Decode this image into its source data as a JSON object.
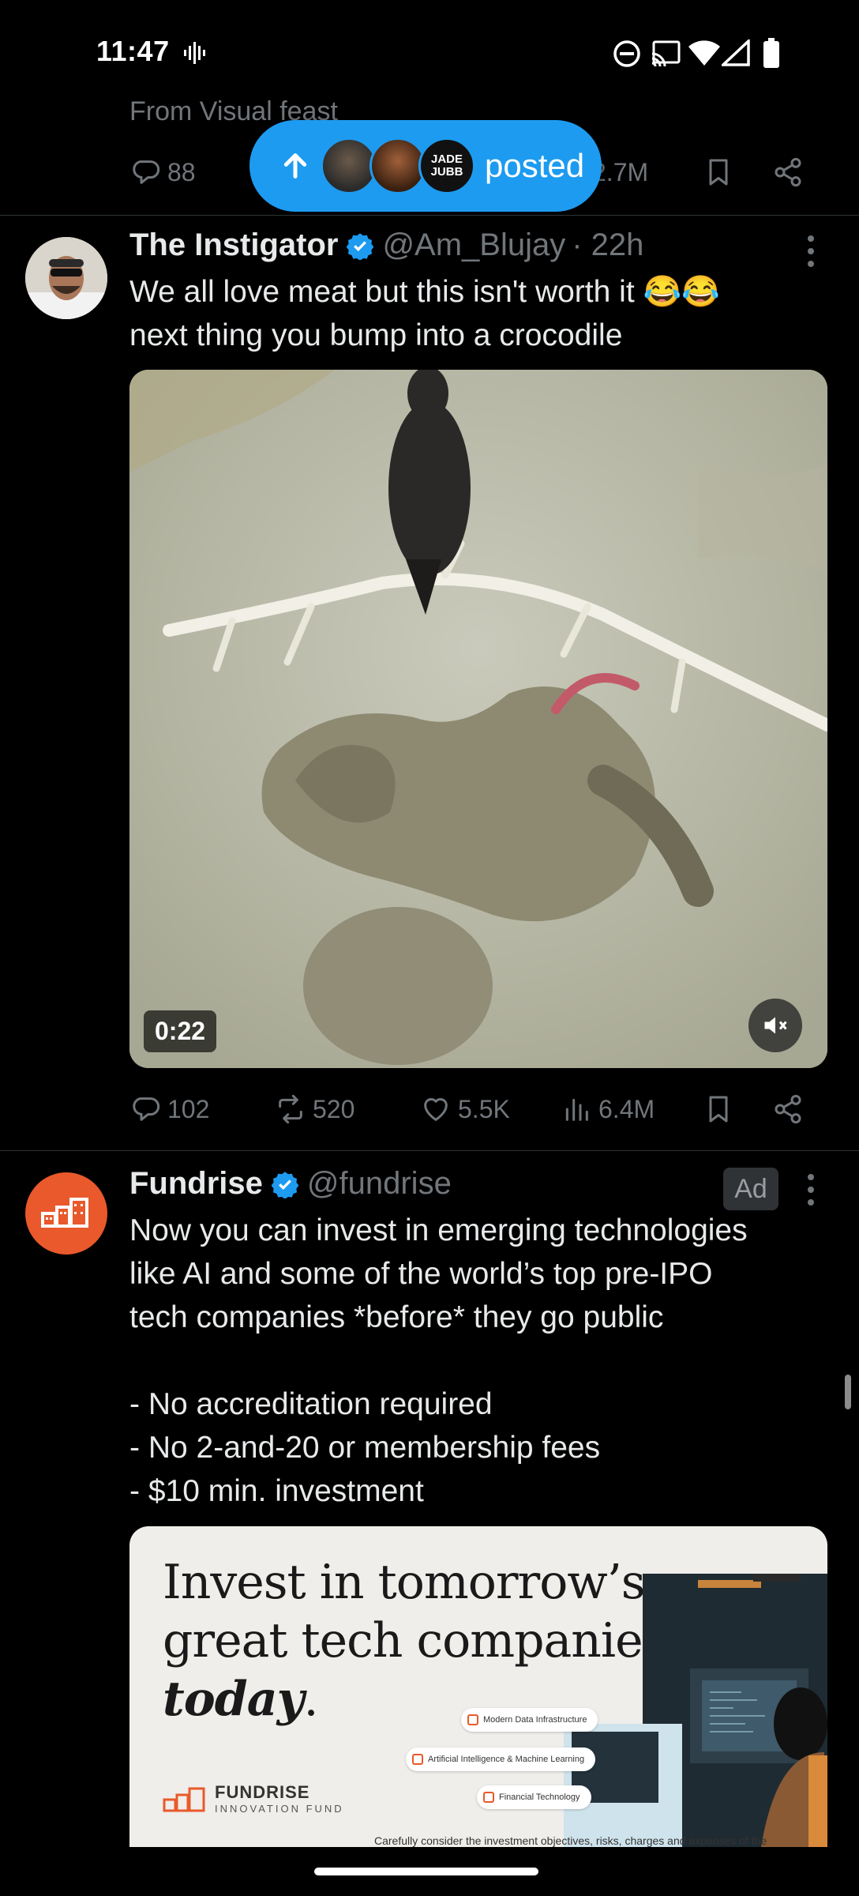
{
  "status_bar": {
    "time": "11:47"
  },
  "prev_tweet": {
    "from_text": "From Visual feast",
    "replies": "88",
    "views": "2.7M"
  },
  "posted_pill": {
    "label": "posted",
    "avatar_text": "JADE\nJUBB"
  },
  "tweet1": {
    "name": "The Instigator",
    "handle": "@Am_Blujay",
    "time": "· 22h",
    "text": "We all love meat but this isn't worth it 😂😂\nnext thing you bump into a crocodile",
    "video_duration": "0:22",
    "replies": "102",
    "reposts": "520",
    "likes": "5.5K",
    "views": "6.4M"
  },
  "tweet2": {
    "name": "Fundrise",
    "handle": "@fundrise",
    "ad_label": "Ad",
    "text": "Now you can invest in emerging technologies\nlike AI and some of the world’s top pre-IPO\ntech companies *before* they go public\n\n- No accreditation required\n- No 2-and-20 or membership fees\n- $10 min. investment",
    "ad_creative": {
      "headline_line1": "Invest in tomorrow’s",
      "headline_line2": "great tech companies,",
      "headline_line3": "today",
      "headline_period": ".",
      "chips": [
        "Modern Data Infrastructure",
        "Artificial Intelligence & Machine Learning",
        "Financial Technology"
      ],
      "logo_name": "FUNDRISE",
      "logo_sub": "INNOVATION FUND",
      "fine_print": "Carefully consider the investment objectives, risks, charges and expenses of the"
    }
  },
  "colors": {
    "accent": "#1d9bf0",
    "muted": "#71767b",
    "fundrise_orange": "#e9592b"
  }
}
